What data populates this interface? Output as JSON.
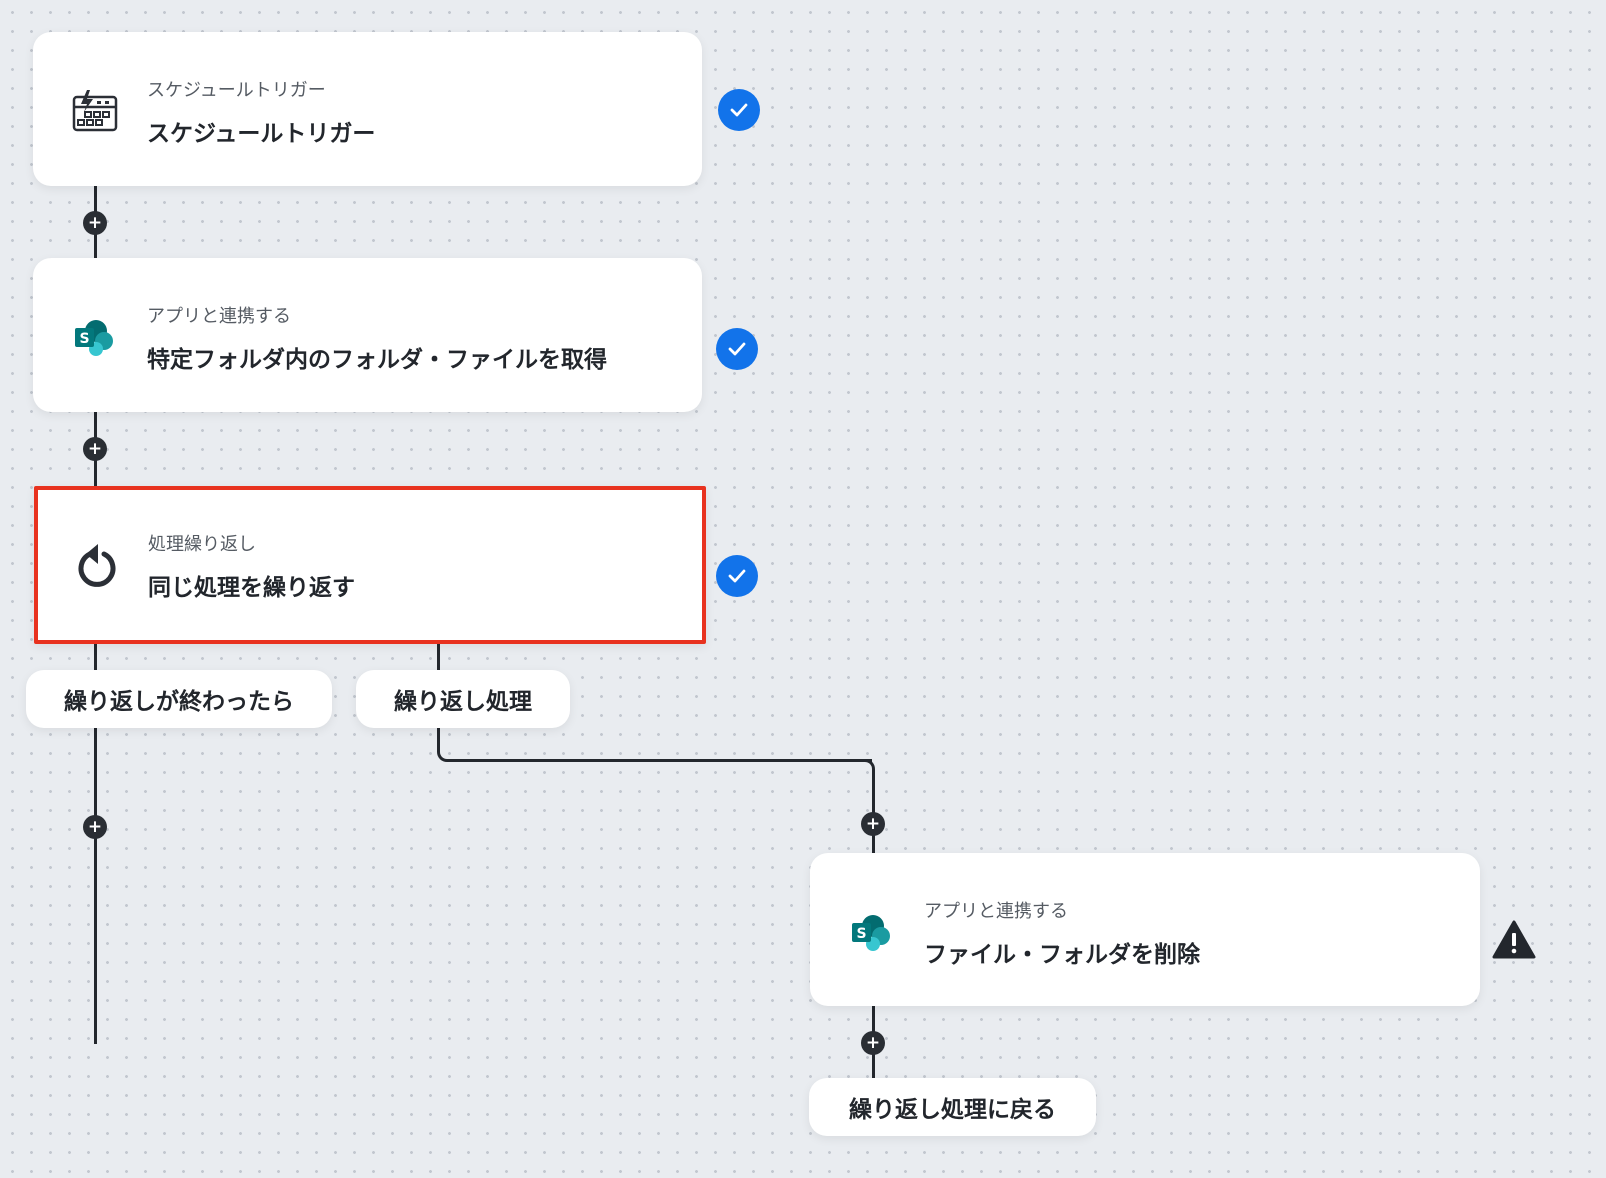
{
  "steps": [
    {
      "subtitle": "スケジュールトリガー",
      "title": "スケジュールトリガー",
      "icon": "calendar-bolt-icon",
      "status": "complete"
    },
    {
      "subtitle": "アプリと連携する",
      "title": "特定フォルダ内のフォルダ・ファイルを取得",
      "icon": "sharepoint-icon",
      "status": "complete"
    },
    {
      "subtitle": "処理繰り返し",
      "title": "同じ処理を繰り返す",
      "icon": "loop-icon",
      "status": "complete",
      "selected": true
    },
    {
      "subtitle": "アプリと連携する",
      "title": "ファイル・フォルダを削除",
      "icon": "sharepoint-icon",
      "status": "warning"
    }
  ],
  "branches": {
    "after_loop": "繰り返しが終わったら",
    "loop_body": "繰り返し処理",
    "back_to_loop": "繰り返し処理に戻る"
  },
  "colors": {
    "check": "#1273ea",
    "selected_border": "#e8321f",
    "connector": "#23272d",
    "warning": "#23272d"
  }
}
